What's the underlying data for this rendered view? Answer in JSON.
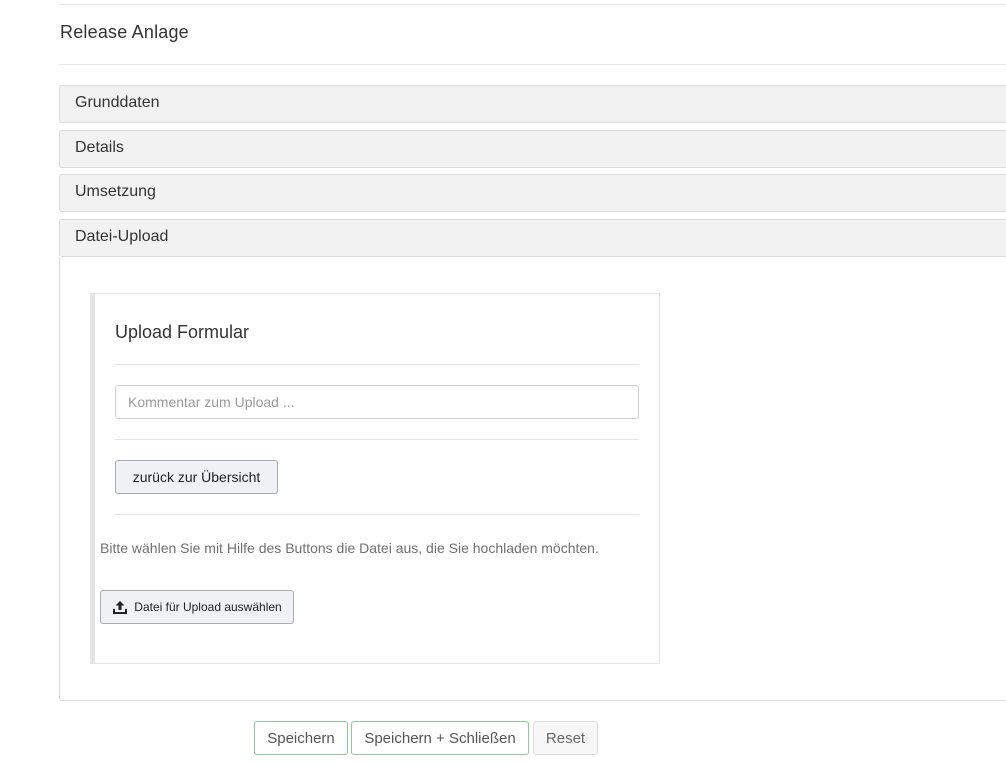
{
  "page": {
    "title": "Release Anlage"
  },
  "accordion": {
    "sections": [
      {
        "label": "Grunddaten"
      },
      {
        "label": "Details"
      },
      {
        "label": "Umsetzung"
      },
      {
        "label": "Datei-Upload"
      }
    ]
  },
  "upload": {
    "title": "Upload Formular",
    "comment_value": "",
    "comment_placeholder": "Kommentar zum Upload ...",
    "back_label": "zurück zur Übersicht",
    "hint": "Bitte wählen Sie mit Hilfe des Buttons die Datei aus, die Sie hochladen möchten.",
    "choose_label": "Datei für Upload auswählen",
    "choose_icon": "upload-icon"
  },
  "footer": {
    "save_label": "Speichern",
    "save_close_label": "Speichern + Schließen",
    "reset_label": "Reset"
  },
  "colors": {
    "success_border": "#8fc89a",
    "panel_header_bg": "#f2f2f2"
  }
}
